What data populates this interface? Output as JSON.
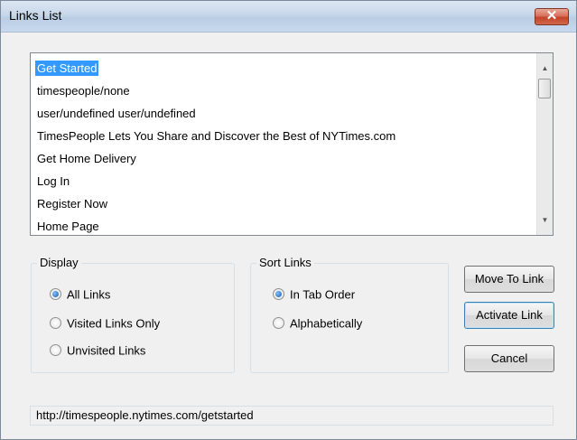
{
  "window": {
    "title": "Links List",
    "close_glyph": "✕"
  },
  "list": {
    "items": [
      {
        "label": "Get Started",
        "selected": true
      },
      {
        "label": "timespeople/none"
      },
      {
        "label": "user/undefined user/undefined"
      },
      {
        "label": "TimesPeople Lets You Share and Discover the Best of NYTimes.com"
      },
      {
        "label": "Get Home Delivery"
      },
      {
        "label": "Log In"
      },
      {
        "label": "Register Now"
      },
      {
        "label": "Home Page"
      }
    ],
    "scroll_up_glyph": "▲",
    "scroll_down_glyph": "▼"
  },
  "display": {
    "label": "Display",
    "options": [
      {
        "label": "All Links",
        "checked": true
      },
      {
        "label": "Visited Links Only",
        "checked": false
      },
      {
        "label": "Unvisited Links",
        "checked": false
      }
    ]
  },
  "sort": {
    "label": "Sort Links",
    "options": [
      {
        "label": "In Tab Order",
        "checked": true
      },
      {
        "label": "Alphabetically",
        "checked": false
      }
    ]
  },
  "buttons": {
    "move_to_link": "Move To Link",
    "activate_link": "Activate Link",
    "cancel": "Cancel"
  },
  "status": {
    "url": "http://timespeople.nytimes.com/getstarted"
  }
}
